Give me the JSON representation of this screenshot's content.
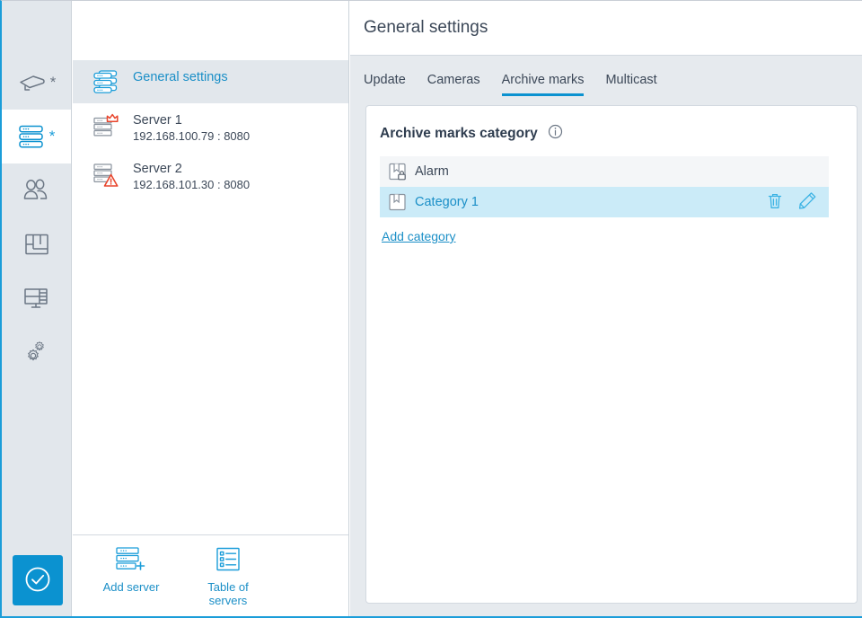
{
  "theme": {
    "accent": "#0b92d0",
    "link": "#1b8fc7",
    "text": "#3c4858",
    "rail_bg": "#e2e7ec",
    "content_bg": "#e6eaee",
    "row_selected": "#cbebf8",
    "row_alt": "#f4f6f8",
    "warning": "#e8452c"
  },
  "rail": {
    "items": [
      {
        "icon": "camera-icon",
        "label": "Cameras",
        "badge": "*",
        "selected": false
      },
      {
        "icon": "servers-icon",
        "label": "Servers",
        "badge": "*",
        "selected": true
      },
      {
        "icon": "users-icon",
        "label": "Users",
        "badge": "",
        "selected": false
      },
      {
        "icon": "layouts-icon",
        "label": "Layouts",
        "badge": "",
        "selected": false
      },
      {
        "icon": "video-walls-icon",
        "label": "Video walls",
        "badge": "",
        "selected": false
      },
      {
        "icon": "gears-icon",
        "label": "System settings",
        "badge": "",
        "selected": false
      }
    ],
    "confirm": {
      "icon": "check-circle-icon",
      "label": "Apply"
    }
  },
  "server_panel": {
    "tree": [
      {
        "icon": "servers-stack-icon",
        "title": "General settings",
        "subtitle": "",
        "selected": true,
        "badge": ""
      },
      {
        "icon": "server-icon",
        "title": "Server 1",
        "subtitle": "192.168.100.79 : 8080",
        "selected": false,
        "badge": "crown-icon"
      },
      {
        "icon": "server-icon",
        "title": "Server 2",
        "subtitle": "192.168.101.30 : 8080",
        "selected": false,
        "badge": "warning-triangle-icon"
      }
    ],
    "footer": [
      {
        "icon": "add-server-icon",
        "label": "Add server"
      },
      {
        "icon": "table-of-servers-icon",
        "label": "Table of\nservers"
      }
    ]
  },
  "content": {
    "title": "General settings",
    "tabs": [
      {
        "label": "Update",
        "active": false
      },
      {
        "label": "Cameras",
        "active": false
      },
      {
        "label": "Archive marks",
        "active": true
      },
      {
        "label": "Multicast",
        "active": false
      }
    ],
    "card": {
      "heading": "Archive marks category",
      "info_icon": "info-icon",
      "categories": [
        {
          "label": "Alarm",
          "icon": "bookmark-locked-icon",
          "locked": true,
          "selected": false
        },
        {
          "label": "Category 1",
          "icon": "bookmark-icon",
          "locked": false,
          "selected": true
        }
      ],
      "row_actions": [
        {
          "icon": "trash-icon",
          "label": "Delete category"
        },
        {
          "icon": "pencil-icon",
          "label": "Edit category"
        }
      ],
      "add_link": "Add category"
    }
  }
}
